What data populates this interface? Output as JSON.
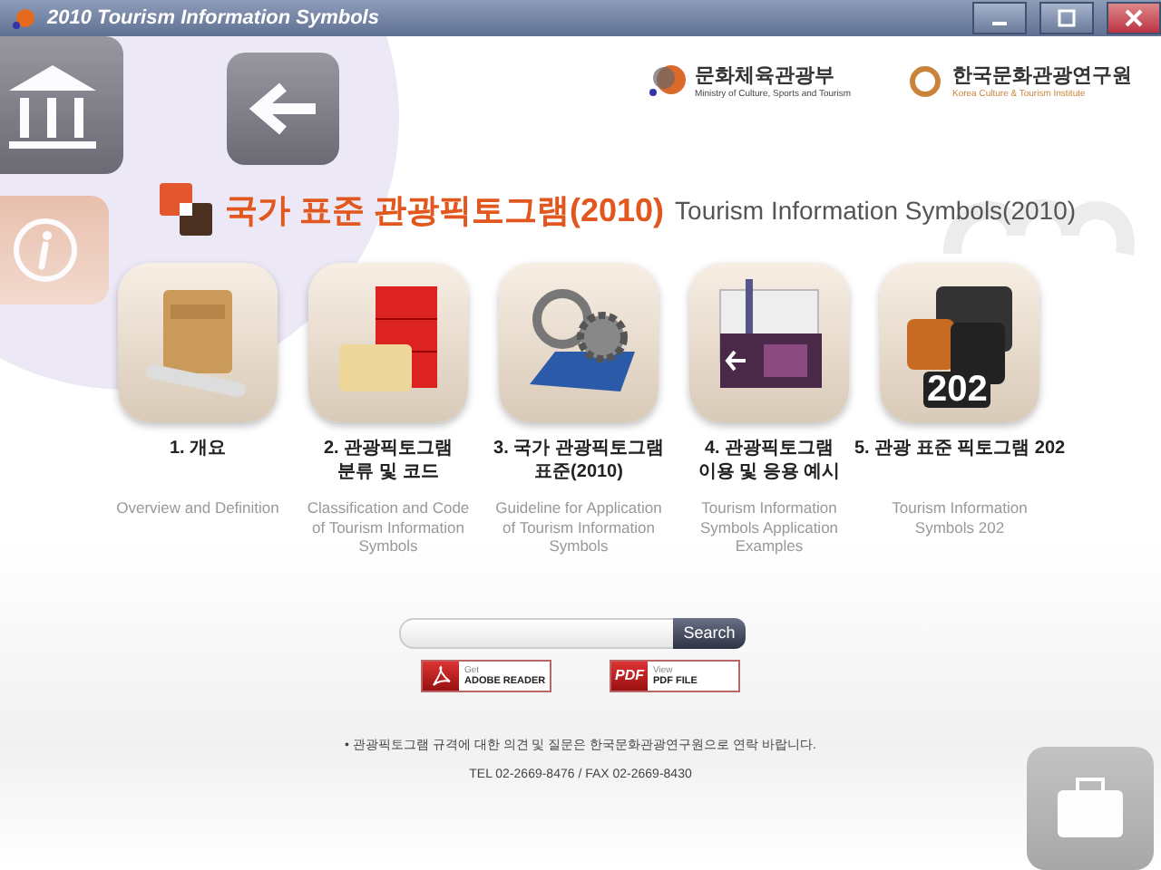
{
  "window": {
    "title": "2010 Tourism Information Symbols"
  },
  "logos": [
    {
      "name": "문화체육관광부",
      "subtitle": "Ministry of Culture, Sports and Tourism"
    },
    {
      "name": "한국문화관광연구원",
      "subtitle": "Korea Culture & Tourism Institute"
    }
  ],
  "heading": {
    "korean": "국가 표준 관광픽토그램(2010)",
    "english": "Tourism Information Symbols(2010)"
  },
  "menu": [
    {
      "title_lines": [
        "1. 개요"
      ],
      "description": "Overview and Definition"
    },
    {
      "title_lines": [
        "2. 관광픽토그램",
        "분류 및 코드"
      ],
      "description": "Classification and Code of Tourism Information Symbols"
    },
    {
      "title_lines": [
        "3. 국가 관광픽토그램",
        "표준(2010)"
      ],
      "description": "Guideline for Application of Tourism Information Symbols"
    },
    {
      "title_lines": [
        "4. 관광픽토그램",
        "이용 및 응용 예시"
      ],
      "description": "Tourism Information Symbols Application Examples"
    },
    {
      "title_lines": [
        "5. 관광 표준 픽토그램 202"
      ],
      "icon_text": "202",
      "description": "Tourism Information Symbols 202"
    }
  ],
  "search": {
    "button": "Search"
  },
  "downloads": [
    {
      "kind": "reader",
      "small": "Get",
      "label": "ADOBE READER"
    },
    {
      "kind": "pdf",
      "badge": "PDF",
      "small": "View",
      "label": "PDF FILE"
    }
  ],
  "footer": {
    "note": "• 관광픽토그램 규격에 대한 의견 및 질문은 한국문화관광연구원으로 연락 바랍니다.",
    "contact": "TEL 02-2669-8476 / FAX 02-2669-8430"
  }
}
